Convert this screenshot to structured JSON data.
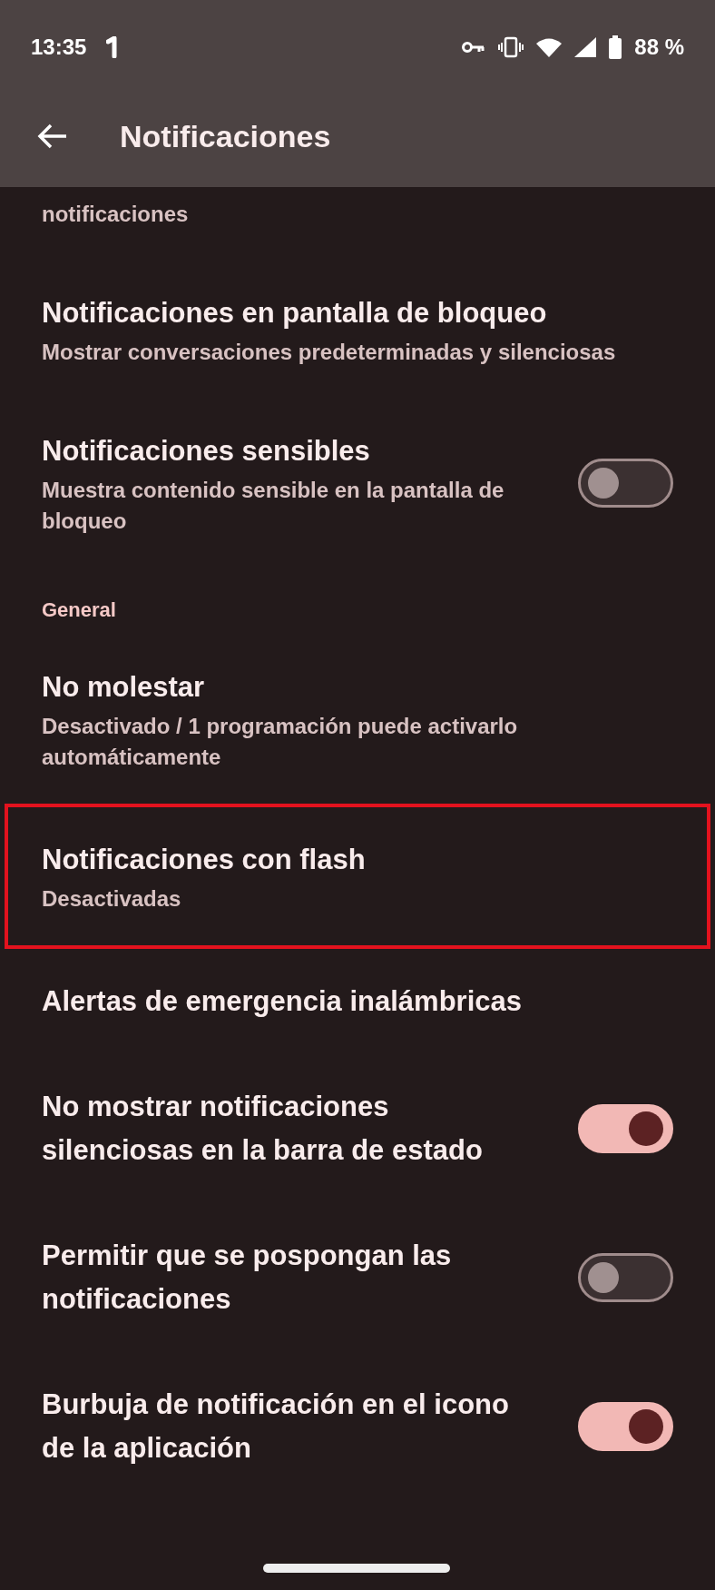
{
  "status_bar": {
    "time": "13:35",
    "battery": "88 %"
  },
  "app_bar": {
    "title": "Notificaciones"
  },
  "items": [
    {
      "kind": "text",
      "summary": "notificaciones"
    },
    {
      "kind": "setting",
      "title": "Notificaciones en pantalla de bloqueo",
      "summary": "Mostrar conversaciones predeterminadas y silenciosas"
    },
    {
      "kind": "toggle",
      "title": "Notificaciones sensibles",
      "summary": "Muestra contenido sensible en la pantalla de bloqueo",
      "on": false
    },
    {
      "kind": "header",
      "title": "General"
    },
    {
      "kind": "setting",
      "title": "No molestar",
      "summary": "Desactivado / 1 programación puede activarlo automáticamente"
    },
    {
      "kind": "setting",
      "title": "Notificaciones con flash",
      "summary": "Desactivadas",
      "highlighted": true
    },
    {
      "kind": "setting",
      "title": "Alertas de emergencia inalámbricas"
    },
    {
      "kind": "toggle",
      "title": "No mostrar notificaciones silenciosas en la barra de estado",
      "on": true
    },
    {
      "kind": "toggle",
      "title": "Permitir que se pospongan las notificaciones",
      "on": false
    },
    {
      "kind": "toggle",
      "title": "Burbuja de notificación en el icono de la aplicación",
      "on": true
    }
  ]
}
